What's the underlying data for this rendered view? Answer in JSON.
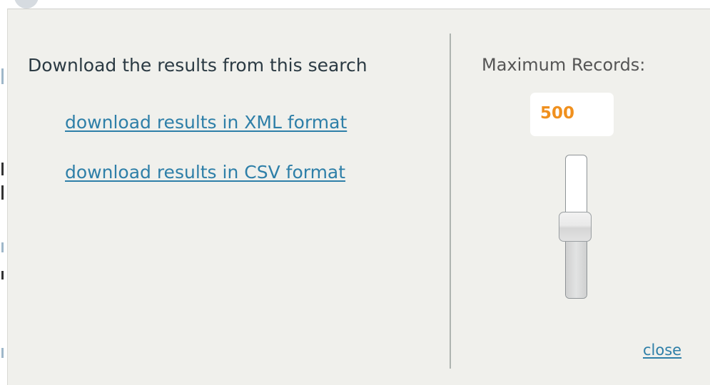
{
  "dialog": {
    "heading": "Download the results from this search",
    "links": {
      "xml": "download results in XML format",
      "csv": "download results in CSV format"
    },
    "max_records": {
      "label": "Maximum Records:",
      "value": "500",
      "slider_fraction": 0.5
    },
    "close_label": "close"
  },
  "colors": {
    "dialog_bg": "#f0f0ec",
    "link": "#2e7fa8",
    "heading_text": "#2b3a43",
    "value_text": "#f0901e",
    "divider": "#aeb4b0"
  }
}
